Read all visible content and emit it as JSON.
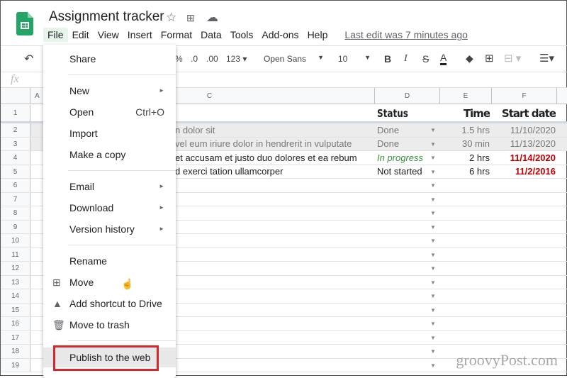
{
  "app": {
    "title": "Assignment tracker",
    "last_edit": "Last edit was 7 minutes ago"
  },
  "menubar": [
    "File",
    "Edit",
    "View",
    "Insert",
    "Format",
    "Data",
    "Tools",
    "Add-ons",
    "Help"
  ],
  "toolbar": {
    "percent": "%",
    "dec_less": ".0",
    "dec_more": ".00",
    "format": "123",
    "font": "Open Sans",
    "size": "10",
    "bold": "B",
    "italic": "I",
    "strike": "S",
    "textcolor": "A"
  },
  "formula": {
    "fx": "fx"
  },
  "columns": [
    "A",
    "C",
    "D",
    "E",
    "F"
  ],
  "rows": [
    {
      "n": "1",
      "c": "",
      "status": "Status",
      "time": "Time",
      "date": "Start date"
    },
    {
      "n": "2",
      "c": "n dolor sit",
      "status": "Done",
      "time": "1.5 hrs",
      "date": "11/10/2020"
    },
    {
      "n": "3",
      "c": "vel eum iriure dolor in hendrerit in vulputate",
      "status": "Done",
      "time": "30 min",
      "date": "11/13/2020"
    },
    {
      "n": "4",
      "c": "et accusam et justo duo dolores et ea rebum",
      "status": "In progress",
      "time": "2 hrs",
      "date": "11/14/2020"
    },
    {
      "n": "5",
      "c": "d exerci tation ullamcorper",
      "status": "Not started",
      "time": "6 hrs",
      "date": "11/2/2016"
    }
  ],
  "empty_rows": [
    "6",
    "7",
    "8",
    "9",
    "10",
    "11",
    "12",
    "13",
    "14",
    "15",
    "16",
    "17",
    "18",
    "19"
  ],
  "file_menu": {
    "share": "Share",
    "new": "New",
    "open": "Open",
    "open_shortcut": "Ctrl+O",
    "import": "Import",
    "copy": "Make a copy",
    "email": "Email",
    "download": "Download",
    "version": "Version history",
    "rename": "Rename",
    "move": "Move",
    "shortcut": "Add shortcut to Drive",
    "trash": "Move to trash",
    "publish": "Publish to the web"
  },
  "colors": {
    "accent_red": "#d8262a",
    "in_progress": "#388e3c",
    "date_red": "#c00000"
  },
  "watermark": "groovyPost.com"
}
